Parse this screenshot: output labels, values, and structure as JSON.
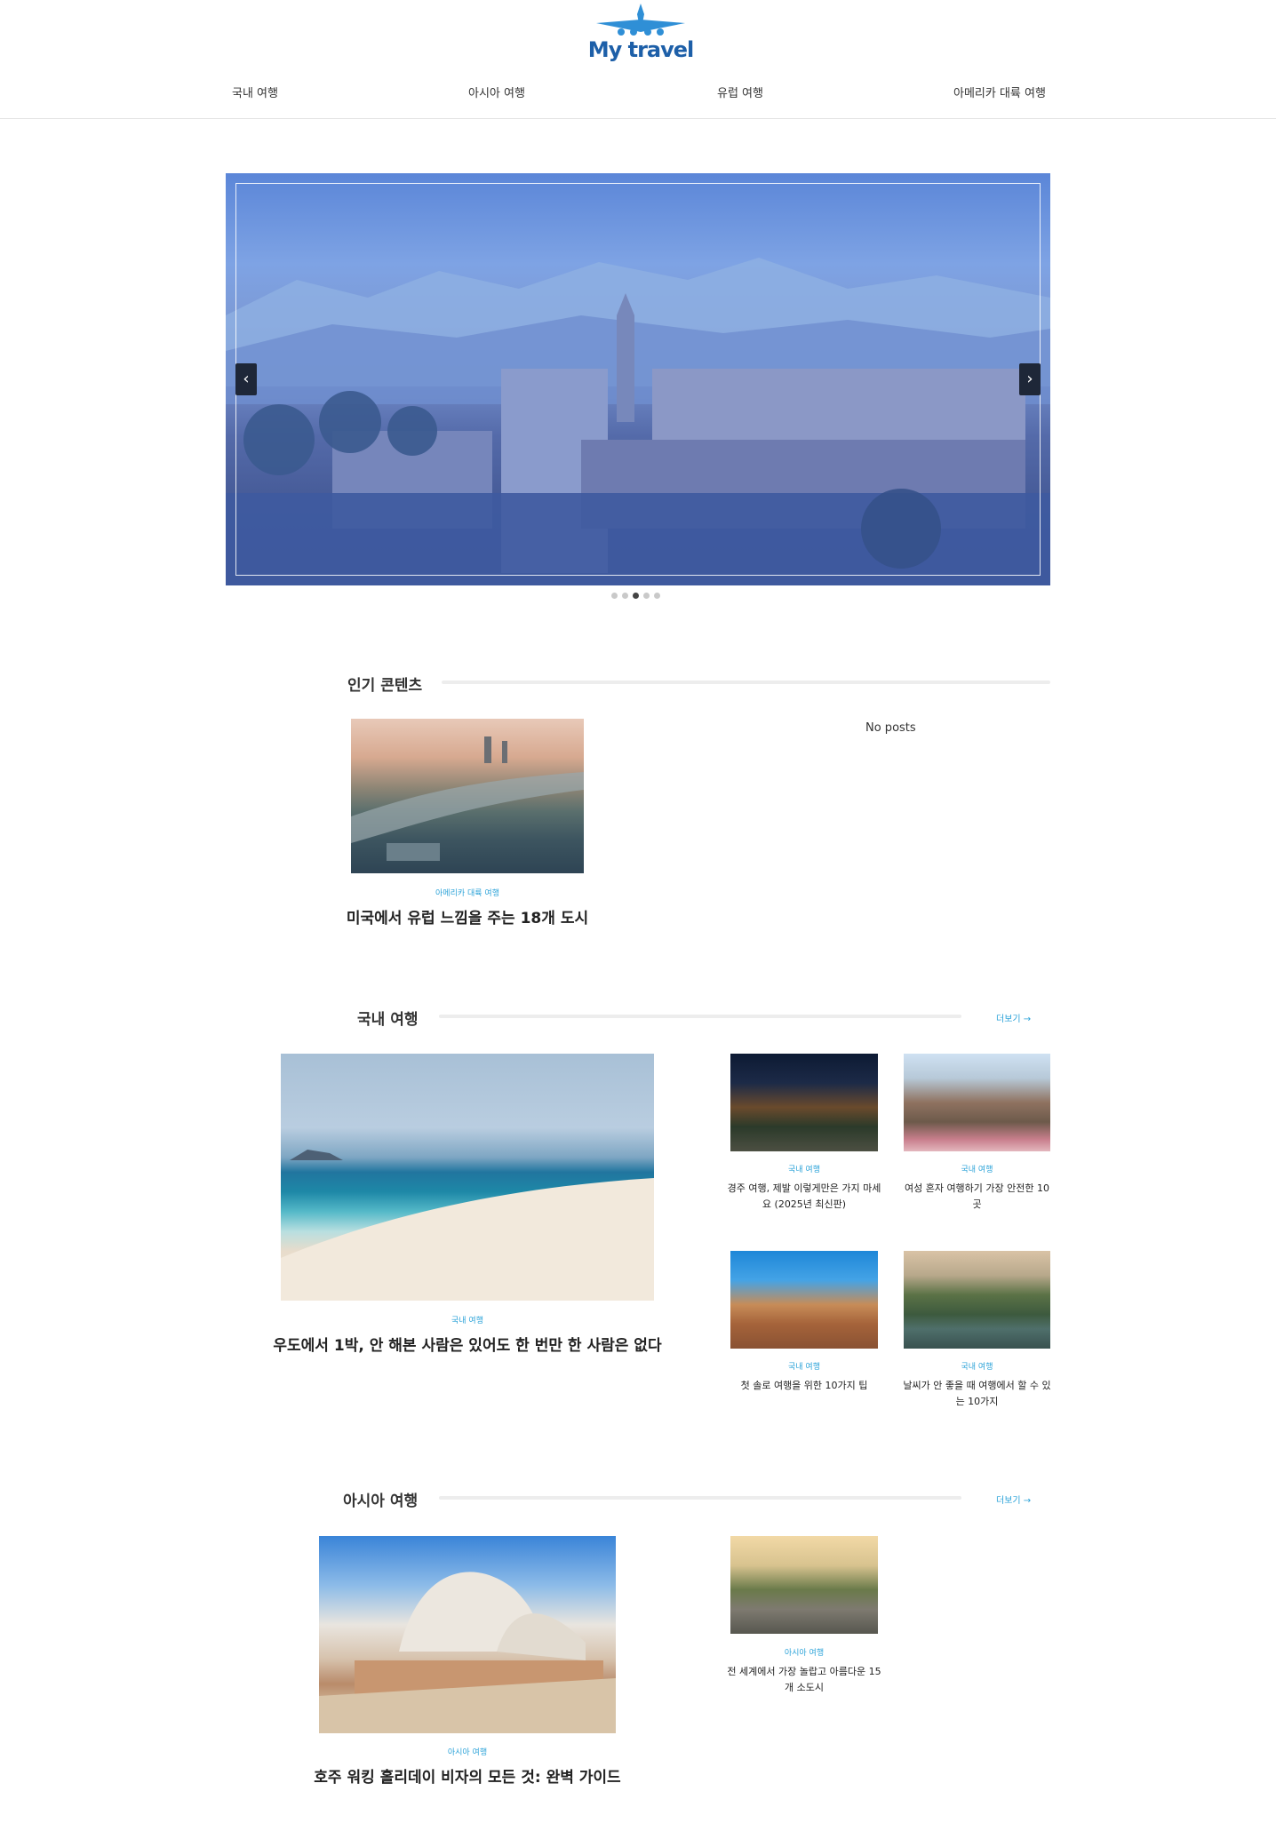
{
  "brand": {
    "name": "My travel",
    "color": "#1d5fa8"
  },
  "nav": [
    "국내 여행",
    "아시아 여행",
    "유럽 여행",
    "아메리카 대륙 여행"
  ],
  "hero": {
    "prev_icon": "chevron-left-icon",
    "next_icon": "chevron-right-icon",
    "slide_count": 5,
    "active_slide": 3
  },
  "popular": {
    "title": "인기 콘텐츠",
    "post": {
      "category": "아메리카 대륙 여행",
      "title": "미국에서 유럽 느낌을 주는 18개 도시"
    },
    "empty_text": "No posts"
  },
  "domestic": {
    "title": "국내 여행",
    "more": "더보기 →",
    "featured": {
      "category": "국내 여행",
      "title": "우도에서 1박, 안 해본 사람은 있어도 한 번만 한 사람은 없다"
    },
    "posts": [
      {
        "category": "국내 여행",
        "title": "경주 여행, 제발 이렇게만은 가지 마세요 (2025년 최신판)"
      },
      {
        "category": "국내 여행",
        "title": "여성 혼자 여행하기 가장 안전한 10곳"
      },
      {
        "category": "국내 여행",
        "title": "첫 솔로 여행을 위한 10가지 팁"
      },
      {
        "category": "국내 여행",
        "title": "날씨가 안 좋을 때 여행에서 할 수 있는 10가지"
      }
    ]
  },
  "asia": {
    "title": "아시아 여행",
    "more": "더보기 →",
    "featured": {
      "category": "아시아 여행",
      "title": "호주 워킹 홀리데이 비자의 모든 것: 완벽 가이드"
    },
    "posts": [
      {
        "category": "아시아 여행",
        "title": "전 세계에서 가장 놀랍고 아름다운 15개 소도시"
      }
    ]
  },
  "colors": {
    "accent": "#2aa2d8",
    "hero_overlay": "#4a75d0"
  }
}
